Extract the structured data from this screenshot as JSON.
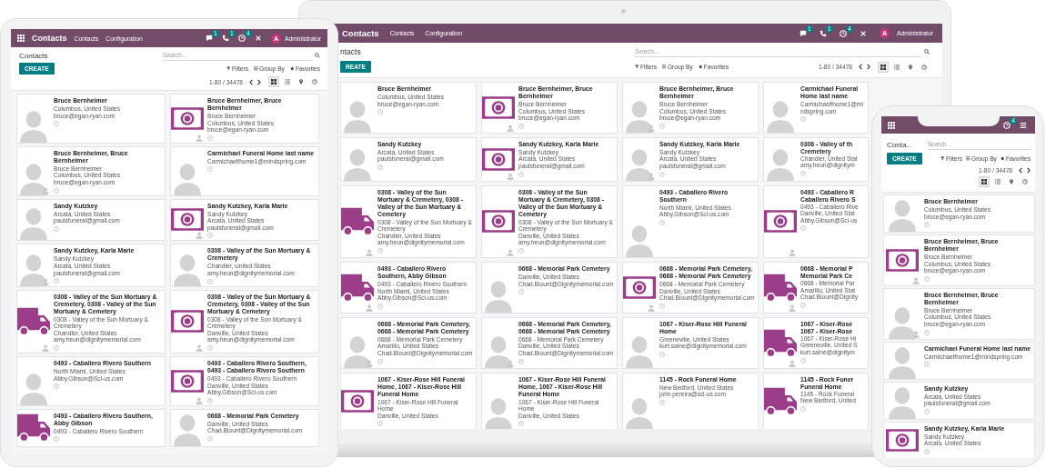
{
  "devices": [
    {
      "kind": "tablet",
      "topbar": {
        "brand": "Contacts",
        "menus": [
          "Contacts",
          "Configuration"
        ],
        "icons": [
          {
            "kind": "chat",
            "count": "1"
          },
          {
            "kind": "phone",
            "count": "1"
          },
          {
            "kind": "clock",
            "count": "4"
          },
          {
            "kind": "close"
          }
        ],
        "user": {
          "avatar": "A",
          "name": "Administrator"
        }
      },
      "control": {
        "title": "Contacts",
        "search_placeholder": "Search...",
        "create": "CREATE",
        "filters": [
          {
            "kind": "filter",
            "label": "Filters"
          },
          {
            "kind": "group",
            "label": "Group By"
          },
          {
            "kind": "favorite",
            "label": "Favorites"
          }
        ],
        "pager": "1-80 / 34478",
        "views": [
          {
            "kind": "kanban",
            "selected": true
          },
          {
            "kind": "list",
            "selected": false
          },
          {
            "kind": "map",
            "selected": false
          },
          {
            "kind": "activity",
            "selected": false
          }
        ]
      },
      "cards": [
        {
          "kind": "person",
          "sub_avatar": false,
          "name": "Bruce Bernheimer",
          "lines": [
            "Columbus, United States",
            "bruce@egan-ryan.com"
          ]
        },
        {
          "kind": "money",
          "sub_avatar": true,
          "name": "Bruce Bernheimer, Bruce Bernheimer",
          "lines": [
            "Bruce Bernheimer",
            "Columbus, United States",
            "bruce@egan-ryan.com"
          ]
        },
        {
          "kind": "person",
          "sub_avatar": true,
          "name": "Bruce Bernheimer, Bruce Bernheimer",
          "lines": [
            "Bruce Bernheimer",
            "Columbus, United States",
            "bruce@egan-ryan.com"
          ]
        },
        {
          "kind": "person",
          "sub_avatar": false,
          "name": "Carmichael Funeral Home last name",
          "lines": [
            "Carmichaelfhome1@mindspring.com"
          ]
        },
        {
          "kind": "person",
          "sub_avatar": false,
          "name": "Sandy Kutzkey",
          "lines": [
            "Arcata, United States",
            "paulsfuneral@gmail.com"
          ]
        },
        {
          "kind": "money",
          "sub_avatar": true,
          "name": "Sandy Kutzkey, Karla Marie",
          "lines": [
            "Sandy Kutzkey",
            "Arcata, United States",
            "paulsfuneral@gmail.com"
          ]
        },
        {
          "kind": "person",
          "sub_avatar": true,
          "name": "Sandy Kutzkey, Karla Marie",
          "lines": [
            "Sandy Kutzkey",
            "Arcata, United States",
            "paulsfuneral@gmail.com"
          ]
        },
        {
          "kind": "person",
          "sub_avatar": false,
          "name": "0308 - Valley of the Sun Mortuary & Cremetery",
          "lines": [
            "Chandler, United States",
            "amy.heun@dignitymemorial.com"
          ]
        },
        {
          "kind": "truck",
          "sub_avatar": true,
          "name": "0308 - Valley of the Sun Mortuary & Cremetery, 0308 - Valley of the Sun Mortuary & Cemetery",
          "lines": [
            "0308 - Valley of the Sun Mortuary & Cremetery",
            "Chandler, United States",
            "amy.heun@dignitymemorial.com"
          ]
        },
        {
          "kind": "money",
          "sub_avatar": true,
          "name": "0308 - Valley of the Sun Mortuary & Cremetery, 0308 - Valley of the Sun Mortuary & Cemetery",
          "lines": [
            "0308 - Valley of the Sun Mortuary & Cremetery",
            "Danville, United States",
            "amy.heun@dignitymemorial.com"
          ]
        },
        {
          "kind": "person",
          "sub_avatar": false,
          "name": "0493 - Caballero Rivero Southern",
          "lines": [
            "North Miami, United States",
            "Abby.Gibson@Sci-us.com"
          ]
        },
        {
          "kind": "money",
          "sub_avatar": true,
          "name": "0493 - Caballero Rivero Southern, 0493 - Caballero Rivero Southern",
          "lines": [
            "0493 - Caballero Rivero Southern",
            "Danville, United States",
            "Abby.Gibson@Sci-us.com"
          ]
        },
        {
          "kind": "truck",
          "sub_avatar": false,
          "name": "0493 - Caballero Rivero Southern, Abby Gibson",
          "lines": [
            "0493 - Caballero Rivero Southern"
          ]
        },
        {
          "kind": "person",
          "sub_avatar": false,
          "name": "0668 - Memorial Park Cemetery",
          "lines": [
            "Danville, United States",
            "Chad.Blount@Dignitymemorial.com"
          ]
        }
      ]
    },
    {
      "kind": "laptop",
      "topbar": {
        "brand": "Contacts",
        "menus": [
          "Contacts",
          "Configuration"
        ],
        "icons": [
          {
            "kind": "chat",
            "count": "1"
          },
          {
            "kind": "phone",
            "count": "1"
          },
          {
            "kind": "clock",
            "count": "4"
          },
          {
            "kind": "close"
          }
        ],
        "user": {
          "avatar": "A",
          "name": "Administrator"
        }
      },
      "control": {
        "title": "ntacts",
        "search_placeholder": "Search...",
        "create": "REATE",
        "filters": [
          {
            "kind": "filter",
            "label": "Filters"
          },
          {
            "kind": "group",
            "label": "Group By"
          },
          {
            "kind": "favorite",
            "label": "Favorites"
          }
        ],
        "pager": "1-80 / 34478",
        "views": [
          {
            "kind": "kanban",
            "selected": true
          },
          {
            "kind": "list",
            "selected": false
          },
          {
            "kind": "map",
            "selected": false
          },
          {
            "kind": "activity",
            "selected": false
          }
        ]
      },
      "cards": [
        {
          "kind": "person",
          "sub_avatar": false,
          "name": "Bruce Bernheimer",
          "lines": [
            "Columbus, United States",
            "bruce@egan-ryan.com"
          ]
        },
        {
          "kind": "money",
          "sub_avatar": true,
          "name": "Bruce Bernheimer, Bruce Bernheimer",
          "lines": [
            "Bruce Bernheimer",
            "Columbus, United States",
            "bruce@egan-ryan.com"
          ]
        },
        {
          "kind": "person",
          "sub_avatar": true,
          "name": "Bruce Bernheimer, Bruce Bernheimer",
          "lines": [
            "Bruce Bernheimer",
            "Columbus, United States",
            "bruce@egan-ryan.com"
          ]
        },
        {
          "kind": "person",
          "sub_avatar": false,
          "name": "Carmichael Funeral Home last name",
          "lines": [
            "Carmichaelfhome1@mindspring.com"
          ]
        },
        {
          "kind": "person",
          "sub_avatar": false,
          "name": "Sandy Kutzkey",
          "lines": [
            "Arcata, United States",
            "paulsfuneral@gmail.com"
          ]
        },
        {
          "kind": "money",
          "sub_avatar": true,
          "name": "Sandy Kutzkey, Karla Marie",
          "lines": [
            "Sandy Kutzkey",
            "Arcata, United States",
            "paulsfuneral@gmail.com"
          ]
        },
        {
          "kind": "person",
          "sub_avatar": true,
          "name": "Sandy Kutzkey, Karla Marie",
          "lines": [
            "Sandy Kutzkey",
            "Arcata, United States",
            "paulsfuneral@gmail.com"
          ]
        },
        {
          "kind": "person",
          "sub_avatar": false,
          "name_parts": [
            "0308 - Valley of th",
            "Cremetery"
          ],
          "lines": [
            "Chandler, United Stat",
            "amy.heun@dignitym"
          ]
        },
        {
          "kind": "truck",
          "sub_avatar": true,
          "name": "0308 - Valley of the Sun Mortuary & Cremetery, 0308 - Valley of the Sun Mortuary & Cemetery",
          "lines": [
            "0308 - Valley of the Sun Mortuary & Cremetery",
            "Chandler, United States",
            "amy.heun@dignitymemorial.com"
          ]
        },
        {
          "kind": "money",
          "sub_avatar": true,
          "name": "0308 - Valley of the Sun Mortuary & Cremetery, 0308 - Valley of the Sun Mortuary & Cemetery",
          "lines": [
            "0308 - Valley of the Sun Mortuary & Cremetery",
            "Danville, United States",
            "amy.heun@dignitymemorial.com"
          ]
        },
        {
          "kind": "person",
          "sub_avatar": false,
          "name": "0493 - Caballero Rivero Southern",
          "lines": [
            "North Miami, United States",
            "Abby.Gibson@Sci-us.com"
          ]
        },
        {
          "kind": "money",
          "sub_avatar": true,
          "name_parts": [
            "0493 - Caballero R",
            "Caballero Rivero S"
          ],
          "lines": [
            "0493 - Caballero Rive",
            "Danville, United Stat",
            "Abby.Gibson@Sci-us"
          ]
        },
        {
          "kind": "truck",
          "sub_avatar": true,
          "name": "0493 - Caballero Rivero Southern, Abby Gibson",
          "lines": [
            "0493 - Caballero Rivero Southern",
            "North Miami, United States",
            "Abby.Gibson@Sci-us.com"
          ]
        },
        {
          "kind": "person",
          "sub_avatar": false,
          "name": "0668 - Memorial Park Cemetery",
          "lines": [
            "Danville, United States",
            "Chad.Blount@Dignitymemorial.com"
          ]
        },
        {
          "kind": "money",
          "sub_avatar": true,
          "name": "0668 - Memorial Park Cemetery, 0668 - Memorial Park Cemetery",
          "lines": [
            "0668 - Memorial Park Cemetery",
            "Danville, United States",
            "Chad.Blount@Dignitymemorial.com"
          ]
        },
        {
          "kind": "truck",
          "sub_avatar": true,
          "name_parts": [
            "0668 - Memorial P",
            "Memorial Park Ce"
          ],
          "lines": [
            "0668 - Memorial Par",
            "Amarillo, United Stat",
            "Chad.Blount@Dignity"
          ]
        },
        {
          "kind": "person",
          "sub_avatar": true,
          "name": "0668 - Memorial Park Cemetery, 0668 - Memorial Park Cemetery",
          "lines": [
            "0668 - Memorial Park Cemetery",
            "Amarillo, United States",
            "Chad.Blount@Dignitymemorial.com"
          ]
        },
        {
          "kind": "person",
          "sub_avatar": true,
          "name": "0668 - Memorial Park Cemetery, 0668 - Memorial Park Cemetery",
          "lines": [
            "0668 - Memorial Park Cemetery",
            "Danville, United States",
            "Chad.Blount@Dignitymemorial.com"
          ]
        },
        {
          "kind": "person",
          "sub_avatar": false,
          "name": "1067 - Kiser-Rose Hill Funeral Home",
          "lines": [
            "Greeneville, United States",
            "kurt.saine@dignitymemorial.com"
          ]
        },
        {
          "kind": "truck",
          "sub_avatar": true,
          "name_parts": [
            "1067 - Kiser-Rose",
            "1067 - Kiser-Rose"
          ],
          "lines": [
            "1067 - Kiser-Rose Hi",
            "Greeneville, United S",
            "kurt.saine@dignitym"
          ]
        },
        {
          "kind": "money",
          "sub_avatar": false,
          "name": "1067 - Kiser-Rose Hill Funeral Home, 1067 - Kiser-Rose Hill Funeral Home",
          "lines": [
            "1067 - Kiser-Rose Hill Funeral Home",
            "Danville, United States"
          ]
        },
        {
          "kind": "person",
          "sub_avatar": false,
          "name": "1067 - Kiser-Rose Hill Funeral Home, 1067 - Kiser-Rose Hill Funeral Home",
          "lines": [
            "1067 - Kiser-Rose Hill Funeral Home",
            "Danville, United States"
          ]
        },
        {
          "kind": "person",
          "sub_avatar": false,
          "name": "1145 - Rock Funeral Home",
          "lines": [
            "New Bedford, United States",
            "john.pereira@sci-us.com"
          ]
        },
        {
          "kind": "truck",
          "sub_avatar": false,
          "name_parts": [
            "1145 - Rock Funer",
            "Funeral Home"
          ],
          "lines": [
            "1145 - Rock Funeral",
            "New Bedford, United"
          ]
        }
      ]
    },
    {
      "kind": "phone",
      "topbar": {
        "icons": [
          {
            "kind": "clock",
            "count": "4"
          },
          {
            "kind": "menu"
          }
        ]
      },
      "control": {
        "title": "Conta...",
        "search_placeholder": "Search...",
        "create": "CREATE",
        "filters": [
          {
            "kind": "filter",
            "label": "Filters"
          },
          {
            "kind": "group",
            "label": "Group By"
          },
          {
            "kind": "favorite",
            "label": "Favorites"
          }
        ],
        "pager": "1-80 / 34478",
        "views": [
          {
            "kind": "kanban",
            "selected": true
          },
          {
            "kind": "list",
            "selected": false
          },
          {
            "kind": "map",
            "selected": false
          },
          {
            "kind": "activity",
            "selected": false
          }
        ]
      },
      "cards": [
        {
          "kind": "person",
          "sub_avatar": false,
          "name": "Bruce Bernheimer",
          "lines": [
            "Columbus, United States",
            "bruce@egan-ryan.com"
          ]
        },
        {
          "kind": "money",
          "sub_avatar": true,
          "name": "Bruce Bernheimer, Bruce Bernheimer",
          "lines": [
            "Bruce Bernheimer",
            "Columbus, United States",
            "bruce@egan-ryan.com"
          ]
        },
        {
          "kind": "person",
          "sub_avatar": true,
          "name": "Bruce Bernheimer, Bruce Bernheimer",
          "lines": [
            "Bruce Bernheimer",
            "Columbus, United States",
            "bruce@egan-ryan.com"
          ]
        },
        {
          "kind": "person",
          "sub_avatar": false,
          "name": "Carmichael Funeral Home last name",
          "lines": [
            "Carmichaelfhome1@mindspring.com"
          ]
        },
        {
          "kind": "person",
          "sub_avatar": false,
          "name": "Sandy Kutzkey",
          "lines": [
            "Arcata, United States",
            "paulsfuneral@gmail.com"
          ]
        },
        {
          "kind": "money",
          "sub_avatar": false,
          "name": "Sandy Kutzkey, Karla Marie",
          "lines": [
            "Sandy Kutzkey",
            "Arcata, United States"
          ]
        }
      ]
    }
  ]
}
